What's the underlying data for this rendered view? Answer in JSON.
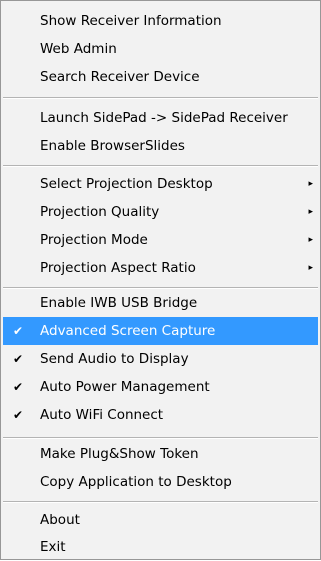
{
  "menu": {
    "items": [
      {
        "label": "Show Receiver Information"
      },
      {
        "label": "Web Admin"
      },
      {
        "label": "Search Receiver Device"
      },
      {
        "label": "Launch SidePad -> SidePad Receiver"
      },
      {
        "label": "Enable BrowserSlides"
      },
      {
        "label": "Select Projection Desktop",
        "submenu_arrow": "▸"
      },
      {
        "label": "Projection Quality",
        "submenu_arrow": "▸"
      },
      {
        "label": "Projection Mode",
        "submenu_arrow": "▸"
      },
      {
        "label": "Projection Aspect Ratio",
        "submenu_arrow": "▸"
      },
      {
        "label": "Enable IWB USB Bridge"
      },
      {
        "label": "Advanced Screen Capture",
        "check": "✔",
        "highlighted": true
      },
      {
        "label": "Send Audio to Display",
        "check": "✔"
      },
      {
        "label": "Auto Power Management",
        "check": "✔"
      },
      {
        "label": "Auto WiFi Connect",
        "check": "✔"
      },
      {
        "label": "Make Plug&Show Token"
      },
      {
        "label": "Copy Application to Desktop"
      },
      {
        "label": "About"
      },
      {
        "label": "Exit"
      }
    ],
    "highlight_color": "#3399ff"
  }
}
